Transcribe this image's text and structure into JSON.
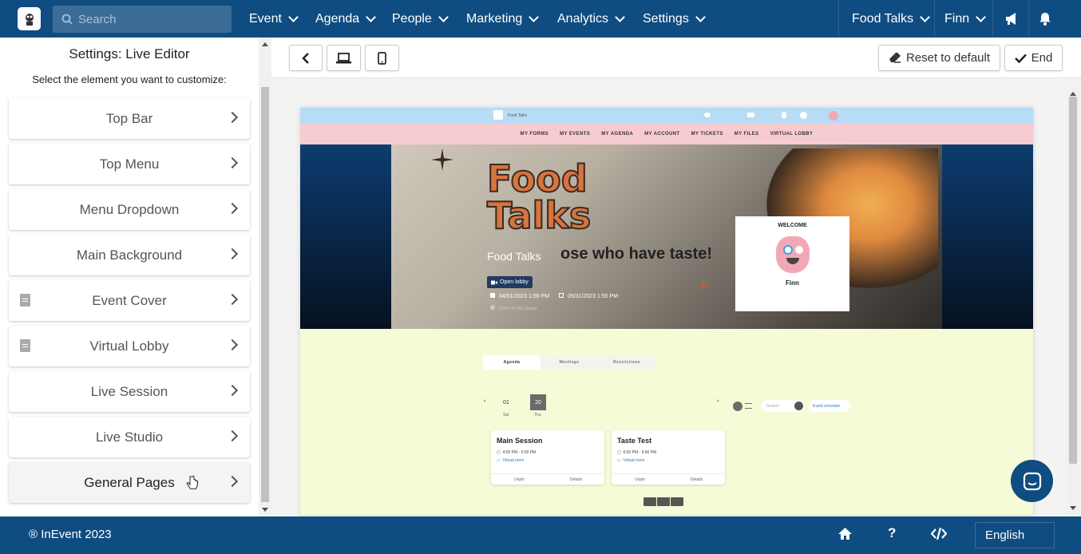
{
  "topnav": {
    "search_placeholder": "Search",
    "menus": [
      "Event",
      "Agenda",
      "People",
      "Marketing",
      "Analytics",
      "Settings"
    ],
    "event_name": "Food Talks",
    "user_name": "Finn",
    "icons": [
      "megaphone-icon",
      "bell-icon"
    ]
  },
  "sidebar": {
    "title": "Settings: Live Editor",
    "subtitle": "Select the element you want to customize:",
    "items": [
      {
        "label": "Top Bar",
        "doc_icon": false
      },
      {
        "label": "Top Menu",
        "doc_icon": false
      },
      {
        "label": "Menu Dropdown",
        "doc_icon": false
      },
      {
        "label": "Main Background",
        "doc_icon": false
      },
      {
        "label": "Event Cover",
        "doc_icon": true
      },
      {
        "label": "Virtual Lobby",
        "doc_icon": true
      },
      {
        "label": "Live Session",
        "doc_icon": false
      },
      {
        "label": "Live Studio",
        "doc_icon": false
      },
      {
        "label": "General Pages",
        "doc_icon": false,
        "active": true
      }
    ]
  },
  "toolbar": {
    "reset_label": "Reset to default",
    "end_label": "End"
  },
  "preview": {
    "topbar_event": "Food Talks",
    "menu": [
      "MY FORMS",
      "MY EVENTS",
      "MY AGENDA",
      "MY ACCOUNT",
      "MY TICKETS",
      "MY FILES",
      "VIRTUAL LOBBY"
    ],
    "title_line1": "Food",
    "title_line2": "Talks",
    "tagline": "Food Talks",
    "tagline2": "ose who have taste!",
    "open_lobby": "Open lobby",
    "start_date": "04/01/2023 1:56 PM",
    "end_date": "05/31/2023 1:55 PM",
    "timezone": "(GMT+07:00) Jakarta",
    "welcome_label": "WELCOME",
    "welcome_name": "Finn",
    "tabs": [
      "Agenda",
      "Meetings",
      "Restrictions"
    ],
    "days": [
      {
        "num": "01",
        "label": "Sat"
      },
      {
        "num": "20",
        "label": "Thu"
      }
    ],
    "search_placeholder": "Search",
    "schedule_select": "Event schedule",
    "sessions": [
      {
        "title": "Main Session",
        "time": "4:00 PM - 5:00 PM",
        "room": "Virtual room",
        "unpin": "Unpin",
        "details": "Details"
      },
      {
        "title": "Taste Test",
        "time": "6:00 PM - 9:00 PM",
        "room": "Virtual room",
        "unpin": "Unpin",
        "details": "Details"
      }
    ]
  },
  "footer": {
    "copyright": "® InEvent 2023",
    "language": "English"
  },
  "colors": {
    "brand": "#0f4c81",
    "preview_topbar": "#b6dcf6",
    "preview_menu": "#f7ccd1",
    "preview_body": "#f4fbd6"
  }
}
